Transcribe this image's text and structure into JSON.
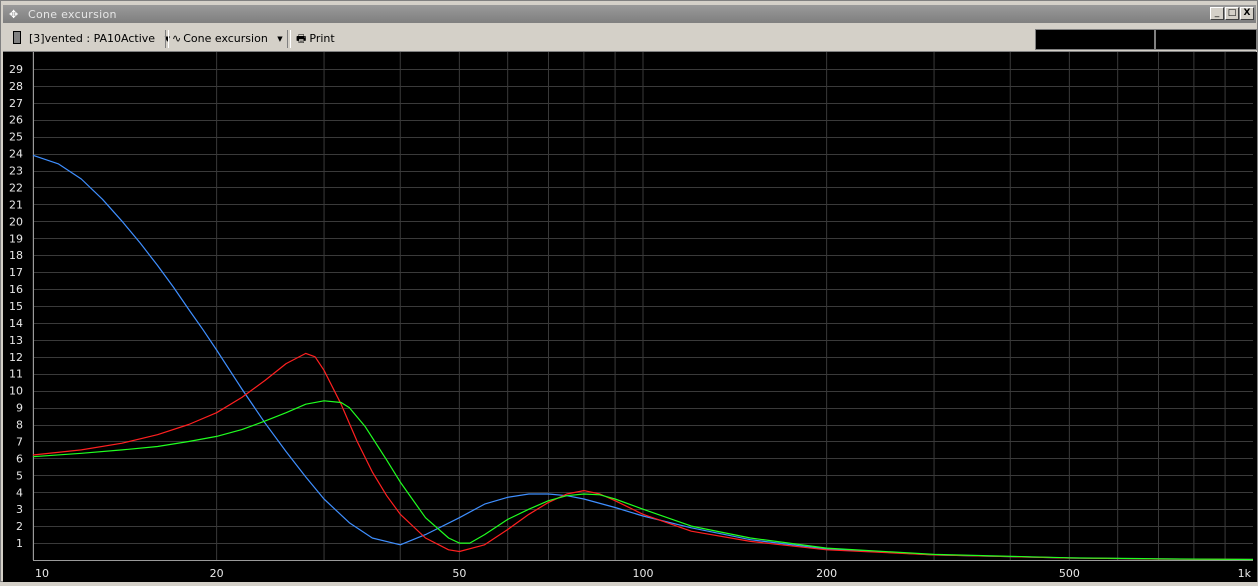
{
  "window": {
    "title": "Cone excursion",
    "buttons": [
      "_",
      "□",
      "X"
    ]
  },
  "toolbar": {
    "project_label": "[3]vented : PA10Active",
    "view_label": "Cone excursion",
    "print_label": "Print"
  },
  "chart_data": {
    "type": "line",
    "xscale": "log",
    "xlim": [
      10,
      1000
    ],
    "ylim": [
      0,
      30
    ],
    "xticks": [
      10,
      20,
      50,
      100,
      200,
      500,
      1000
    ],
    "xtick_labels": [
      "10",
      "20",
      "50",
      "100",
      "200",
      "500",
      "1k"
    ],
    "yticks": [
      1,
      2,
      3,
      4,
      5,
      6,
      7,
      8,
      9,
      10,
      11,
      12,
      13,
      14,
      15,
      16,
      17,
      18,
      19,
      20,
      21,
      22,
      23,
      24,
      25,
      26,
      27,
      28,
      29
    ],
    "ytick_labels": [
      "1",
      "2",
      "3",
      "4",
      "5",
      "6",
      "7",
      "8",
      "9",
      "10",
      "11",
      "12",
      "13",
      "14",
      "15",
      "16",
      "17",
      "18",
      "19",
      "20",
      "21",
      "22",
      "23",
      "24",
      "25",
      "26",
      "27",
      "28",
      "29"
    ],
    "grid": true,
    "series": [
      {
        "color": "#3f8fff",
        "x": [
          10,
          11,
          12,
          13,
          14,
          15,
          16,
          17,
          18,
          19,
          20,
          22,
          24,
          26,
          28,
          30,
          33,
          36,
          40,
          44,
          50,
          55,
          60,
          65,
          70,
          75,
          80,
          90,
          100,
          120,
          150,
          200,
          300,
          500,
          700,
          1000
        ],
        "y": [
          23.9,
          23.4,
          22.5,
          21.3,
          20.0,
          18.7,
          17.4,
          16.1,
          14.8,
          13.6,
          12.4,
          10.1,
          8.1,
          6.4,
          4.9,
          3.6,
          2.2,
          1.3,
          0.9,
          1.5,
          2.5,
          3.3,
          3.7,
          3.9,
          3.9,
          3.8,
          3.6,
          3.1,
          2.6,
          1.9,
          1.2,
          0.65,
          0.3,
          0.12,
          0.06,
          0.03
        ]
      },
      {
        "color": "#ff2020",
        "x": [
          10,
          12,
          14,
          16,
          18,
          20,
          22,
          24,
          26,
          28,
          29,
          30,
          32,
          34,
          36,
          38,
          40,
          44,
          48,
          50,
          55,
          60,
          65,
          70,
          75,
          80,
          85,
          90,
          100,
          120,
          150,
          200,
          300,
          500,
          700,
          1000
        ],
        "y": [
          6.2,
          6.5,
          6.9,
          7.4,
          8.0,
          8.7,
          9.6,
          10.6,
          11.6,
          12.2,
          12.0,
          11.2,
          9.2,
          7.0,
          5.2,
          3.8,
          2.7,
          1.3,
          0.6,
          0.5,
          0.9,
          1.8,
          2.7,
          3.4,
          3.9,
          4.1,
          3.9,
          3.5,
          2.7,
          1.7,
          1.1,
          0.6,
          0.3,
          0.12,
          0.06,
          0.03
        ]
      },
      {
        "color": "#20ff20",
        "x": [
          10,
          12,
          14,
          16,
          18,
          20,
          22,
          24,
          26,
          28,
          30,
          32,
          33,
          35,
          38,
          40,
          44,
          48,
          50,
          52,
          55,
          60,
          65,
          70,
          75,
          80,
          85,
          90,
          100,
          120,
          150,
          200,
          300,
          500,
          700,
          1000
        ],
        "y": [
          6.1,
          6.3,
          6.5,
          6.7,
          7.0,
          7.3,
          7.7,
          8.2,
          8.7,
          9.2,
          9.4,
          9.3,
          9.0,
          7.9,
          5.9,
          4.6,
          2.5,
          1.3,
          1.0,
          1.0,
          1.5,
          2.4,
          3.0,
          3.5,
          3.8,
          3.9,
          3.85,
          3.6,
          3.0,
          2.0,
          1.3,
          0.7,
          0.33,
          0.13,
          0.07,
          0.03
        ]
      }
    ]
  }
}
